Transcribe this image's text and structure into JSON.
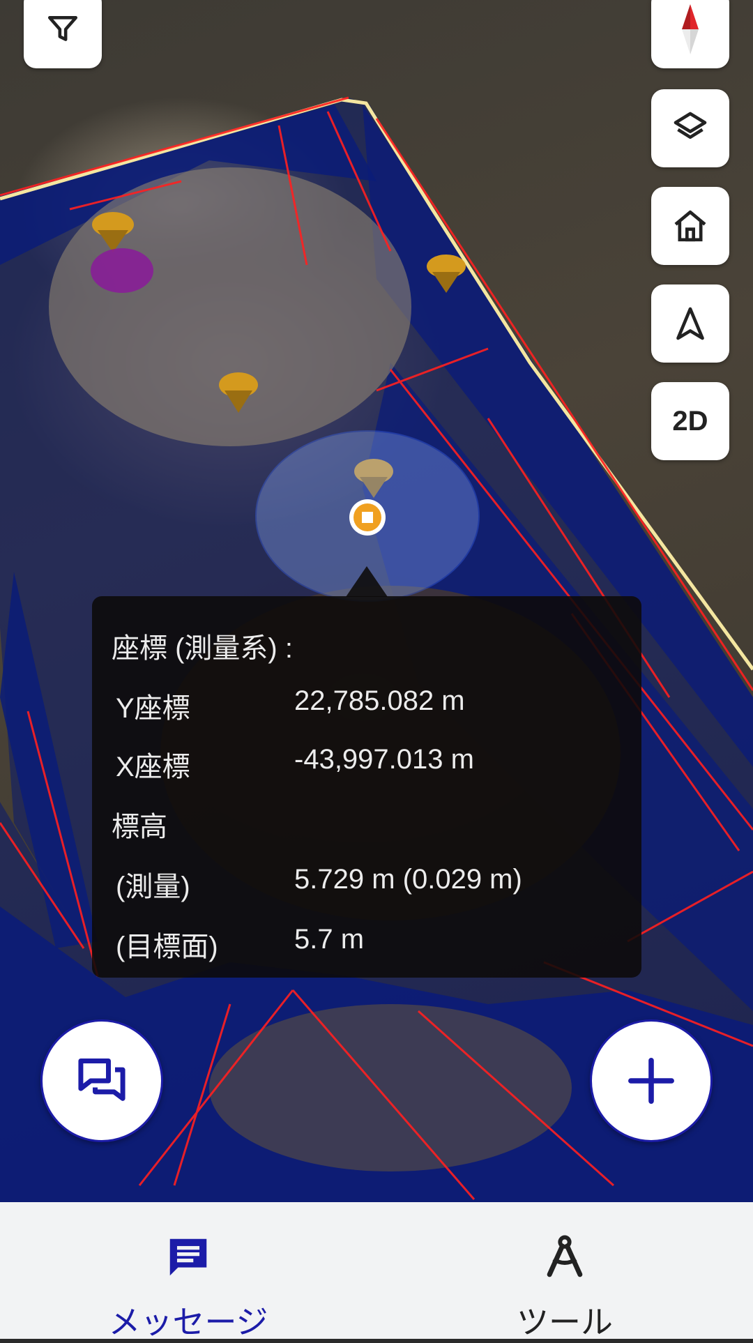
{
  "map": {
    "measurement": {
      "header": "座標 (測量系) :",
      "rows": [
        {
          "label": "Y座標",
          "value": "22,785.082 m"
        },
        {
          "label": "X座標",
          "value": "-43,997.013 m"
        },
        {
          "label": "標高",
          "value": ""
        },
        {
          "label": "(測量)",
          "value": "5.729 m (0.029 m)"
        },
        {
          "label": "(目標面)",
          "value": "5.7 m"
        }
      ]
    }
  },
  "controls": {
    "filter_icon": "filter-icon",
    "compass_icon": "compass-icon",
    "layers_icon": "layers-icon",
    "home_icon": "home-icon",
    "navigate_icon": "navigation-arrow-icon",
    "view_mode_label": "2D"
  },
  "fabs": {
    "messages_icon": "chat-icon",
    "add_icon": "plus-icon"
  },
  "bottom_nav": {
    "items": [
      {
        "label": "メッセージ",
        "icon": "message-icon",
        "active": true
      },
      {
        "label": "ツール",
        "icon": "compass-tool-icon",
        "active": false
      }
    ]
  },
  "colors": {
    "accent": "#1c1ca8",
    "nav_active": "#1c1ca8",
    "nav_inactive": "#222222",
    "marker": "#f0a020",
    "site_blue": "#0a1a6e",
    "breakline_red": "#ff2020"
  }
}
